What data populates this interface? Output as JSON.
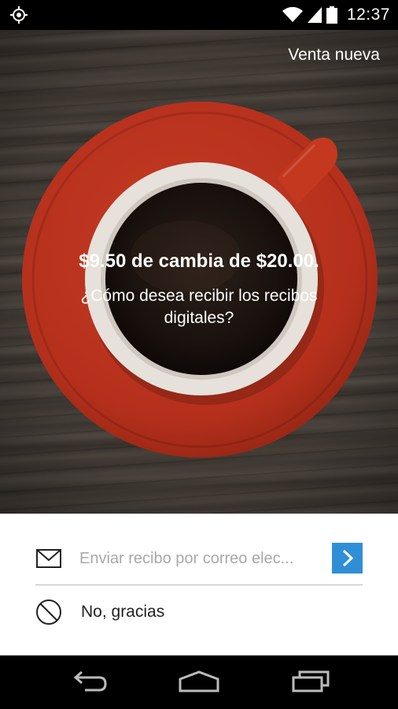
{
  "status_bar": {
    "time": "12:37",
    "icons": [
      "location-icon",
      "wifi-icon",
      "signal-icon",
      "battery-icon"
    ]
  },
  "header": {
    "new_sale_label": "Venta nueva"
  },
  "hero": {
    "change_text": "$9.50 de cambia de $20.00.",
    "question_text": "¿Cómo desea recibir los recibos digitales?"
  },
  "receipt_options": {
    "email_placeholder": "Enviar recibo por correo elec...",
    "email_icon": "mail-icon",
    "send_icon": "chevron-right-icon",
    "no_thanks_label": "No, gracias",
    "no_thanks_icon": "no-icon"
  },
  "nav_bar": {
    "icons": [
      "back-icon",
      "home-icon",
      "recent-apps-icon"
    ]
  },
  "colors": {
    "accent": "#2f8fd6",
    "saucer": "#b8321e",
    "cup_rim": "#e7e2dc",
    "coffee": "#1b1410"
  }
}
